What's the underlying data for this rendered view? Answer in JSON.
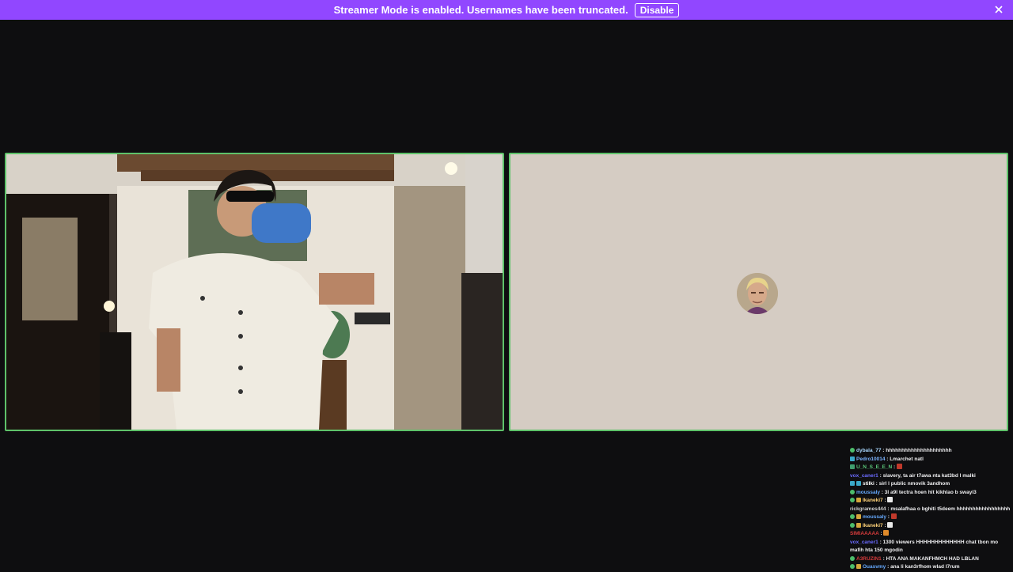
{
  "banner": {
    "text": "Streamer Mode is enabled. Usernames have been truncated.",
    "disable_label": "Disable",
    "color": "#9147ff"
  },
  "tiles": {
    "speaking_border": "#5ec26a",
    "avatar_bg": "#d5ccc3"
  },
  "chat": {
    "messages": [
      {
        "user": "dybala_77",
        "color": "#aad8ff",
        "text": "hhhhhhhhhhhhhhhhhhhhh",
        "badges": [
          "green"
        ]
      },
      {
        "user": "Pedro10014",
        "color": "#7ab3ff",
        "text": "Lmarchet natl",
        "badges": [
          "teal"
        ]
      },
      {
        "user": "U_N_S_E_E_N",
        "color": "#5ac77a",
        "text": "",
        "badges": [
          "sub"
        ],
        "emote": "red"
      },
      {
        "user": "vox_caner1",
        "color": "#6b6bff",
        "text": "slavery, ta air t7awa nta kat3bd l malki",
        "badges": []
      },
      {
        "user": "stilki",
        "color": "#ffffff",
        "text": "sirl l public nmovik 3andhom",
        "badges": [
          "teal",
          "teal"
        ]
      },
      {
        "user": "moussaly",
        "color": "#66aaff",
        "text": "3l a9l tectra hoen hit kikhlao b swayi3",
        "badges": [
          "green"
        ]
      },
      {
        "user": "Ikaneki7",
        "color": "#ffd37a",
        "text": "",
        "badges": [
          "green",
          "gold"
        ],
        "emote": "white"
      },
      {
        "user": "rickgrames444",
        "color": "#cfcfcf",
        "text": "msalafhaa o bghiti t5deem hhhhhhhhhhhhhhhhh",
        "badges": []
      },
      {
        "user": "moussaly",
        "color": "#66aaff",
        "text": "",
        "badges": [
          "green",
          "gold"
        ],
        "emote": "red"
      },
      {
        "user": "Ikaneki7",
        "color": "#ffd37a",
        "text": "",
        "badges": [
          "green",
          "gold"
        ],
        "emote": "white"
      },
      {
        "user": "SIMIAAAAA",
        "color": "#d43b3b",
        "text": "",
        "badges": [],
        "emote": "orange"
      },
      {
        "user": "vox_caner1",
        "color": "#6b6bff",
        "text": "1300 viewers HHHHHHHHHHHHH chat tbon mo mafih hta 150 mgodin",
        "badges": [],
        "wrap": true
      },
      {
        "user": "A3RUZIN1",
        "color": "#d43b3b",
        "text": "HTA ANA MAKANFHMCH HAD LBLAN",
        "badges": [
          "green"
        ]
      },
      {
        "user": "Ouasvmy",
        "color": "#66aaff",
        "text": "ana li kan3rfhom wlad l7rum",
        "badges": [
          "green",
          "gold"
        ]
      }
    ]
  }
}
